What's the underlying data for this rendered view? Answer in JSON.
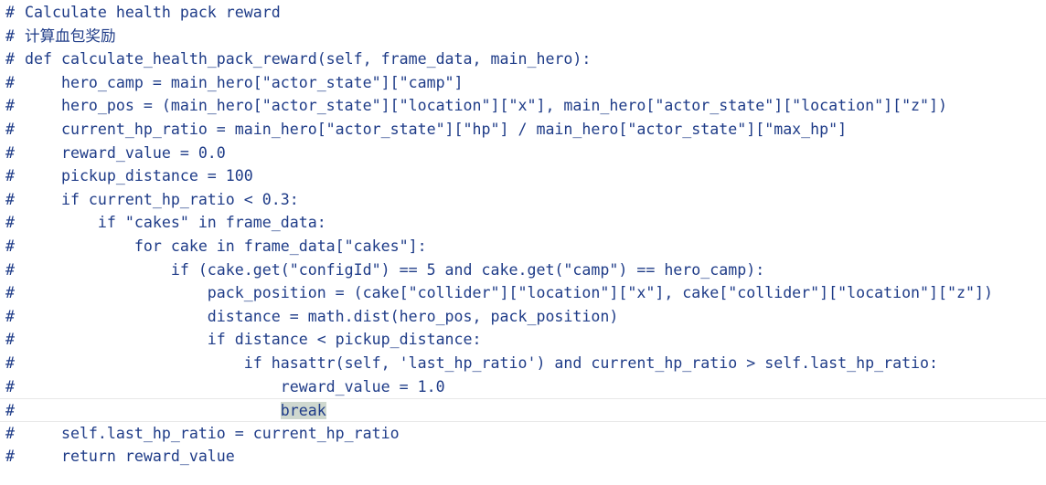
{
  "editor": {
    "lines": [
      {
        "marker": "#",
        "text": "Calculate health pack reward"
      },
      {
        "marker": "#",
        "text": "计算血包奖励"
      },
      {
        "marker": "#",
        "text": "def calculate_health_pack_reward(self, frame_data, main_hero):"
      },
      {
        "marker": "#",
        "text": "    hero_camp = main_hero[\"actor_state\"][\"camp\"]"
      },
      {
        "marker": "#",
        "text": "    hero_pos = (main_hero[\"actor_state\"][\"location\"][\"x\"], main_hero[\"actor_state\"][\"location\"][\"z\"])"
      },
      {
        "marker": "#",
        "text": "    current_hp_ratio = main_hero[\"actor_state\"][\"hp\"] / main_hero[\"actor_state\"][\"max_hp\"]"
      },
      {
        "marker": "#",
        "text": "    reward_value = 0.0"
      },
      {
        "marker": "#",
        "text": "    pickup_distance = 100"
      },
      {
        "marker": "#",
        "text": "    if current_hp_ratio < 0.3:"
      },
      {
        "marker": "#",
        "text": "        if \"cakes\" in frame_data:"
      },
      {
        "marker": "#",
        "text": "            for cake in frame_data[\"cakes\"]:"
      },
      {
        "marker": "#",
        "text": "                if (cake.get(\"configId\") == 5 and cake.get(\"camp\") == hero_camp):"
      },
      {
        "marker": "#",
        "text": "                    pack_position = (cake[\"collider\"][\"location\"][\"x\"], cake[\"collider\"][\"location\"][\"z\"])"
      },
      {
        "marker": "#",
        "text": "                    distance = math.dist(hero_pos, pack_position)"
      },
      {
        "marker": "#",
        "text": "                    if distance < pickup_distance:"
      },
      {
        "marker": "#",
        "text": "                        if hasattr(self, 'last_hp_ratio') and current_hp_ratio > self.last_hp_ratio:"
      },
      {
        "marker": "#",
        "text": "                            reward_value = 1.0"
      },
      {
        "marker": "#",
        "indent": "                            ",
        "selected": "break",
        "current": true
      },
      {
        "marker": "#",
        "text": "    self.last_hp_ratio = current_hp_ratio"
      },
      {
        "marker": "#",
        "text": "    return reward_value"
      }
    ]
  }
}
